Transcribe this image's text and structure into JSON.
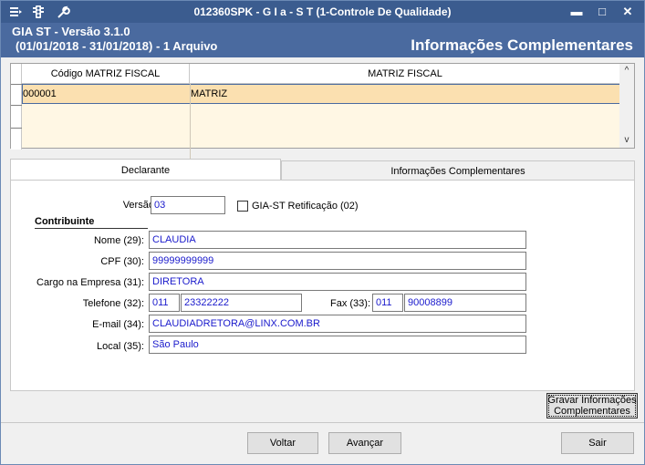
{
  "window": {
    "title": "012360SPK - G I a - S T (1-Controle De Qualidade)",
    "icons": [
      "menu-icon",
      "traffic-light-icon",
      "wrench-icon"
    ],
    "controls": [
      "minimize-icon",
      "maximize-icon",
      "close-icon"
    ]
  },
  "header": {
    "app_version": "GIA ST - Versão 3.1.0",
    "period": "(01/01/2018 - 31/01/2018) - 1 Arquivo",
    "section_title": "Informações Complementares"
  },
  "grid": {
    "columns": [
      "Código MATRIZ FISCAL",
      "MATRIZ FISCAL"
    ],
    "rows": [
      {
        "code": "000001",
        "name": "MATRIZ"
      }
    ]
  },
  "tabs": [
    {
      "label": "Declarante",
      "active": true
    },
    {
      "label": "Informações Complementares",
      "active": false
    }
  ],
  "form": {
    "versao_label": "Versão:",
    "versao_value": "03",
    "retificacao_label": "GIA-ST Retificação (02)",
    "retificacao_checked": false,
    "section": "Contribuinte",
    "nome_label": "Nome (29):",
    "nome_value": "CLAUDIA",
    "cpf_label": "CPF (30):",
    "cpf_value": "99999999999",
    "cargo_label": "Cargo na Empresa (31):",
    "cargo_value": "DIRETORA",
    "telefone_label": "Telefone (32):",
    "telefone_ddd": "011",
    "telefone_numero": "23322222",
    "fax_label": "Fax (33):",
    "fax_ddd": "011",
    "fax_numero": "90008899",
    "email_label": "E-mail (34):",
    "email_value": "CLAUDIADRETORA@LINX.COM.BR",
    "local_label": "Local (35):",
    "local_value": "São Paulo"
  },
  "buttons": {
    "gravar_line1": "Gravar Informações",
    "gravar_line2": "Complementares",
    "voltar": "Voltar",
    "avancar": "Avançar",
    "sair": "Sair"
  },
  "colors": {
    "titlebar": "#3b5c8f",
    "header": "#4a6a9f",
    "selected_row": "#fbe0b0",
    "field_text": "#1a1acc"
  }
}
